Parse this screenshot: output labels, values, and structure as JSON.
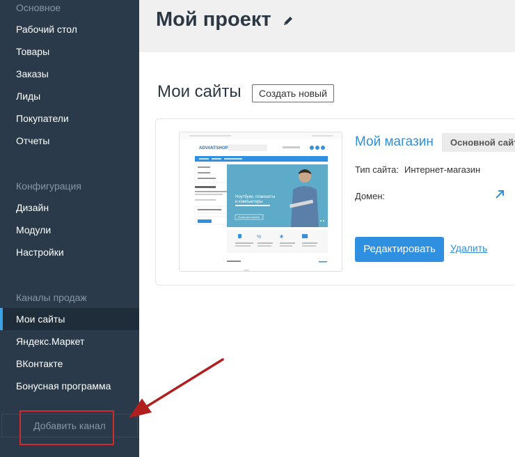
{
  "sidebar": {
    "sections": [
      {
        "heading": "Основное",
        "items": [
          "Рабочий стол",
          "Товары",
          "Заказы",
          "Лиды",
          "Покупатели",
          "Отчеты"
        ]
      },
      {
        "heading": "Конфигурация",
        "items": [
          "Дизайн",
          "Модули",
          "Настройки"
        ]
      },
      {
        "heading": "Каналы продаж",
        "items": [
          "Мои сайты",
          "Яндекс.Маркет",
          "ВКонтакте",
          "Бонусная программа"
        ]
      }
    ],
    "active_item": "Мои сайты",
    "add_channel": "Добавить канал"
  },
  "header": {
    "title": "Мой проект"
  },
  "main": {
    "section_title": "Мои сайты",
    "create_button": "Создать новый",
    "site": {
      "name": "Мой магазин",
      "badge": "Основной сайт",
      "type_label": "Тип сайта:",
      "type_value": "Интернет-магазин",
      "domain_label": "Домен:",
      "edit_button": "Редактировать",
      "delete_link": "Удалить"
    }
  },
  "thumbnail": {
    "logo": "ADVANTSHOP",
    "banner_line1": "Ноутбуки, планшеты",
    "banner_line2": "и компьютеры",
    "banner_button": "Посмотреть каталог"
  },
  "colors": {
    "sidebar_bg": "#2a3a4a",
    "accent": "#2f8fe0",
    "highlight": "#d42a2a"
  }
}
